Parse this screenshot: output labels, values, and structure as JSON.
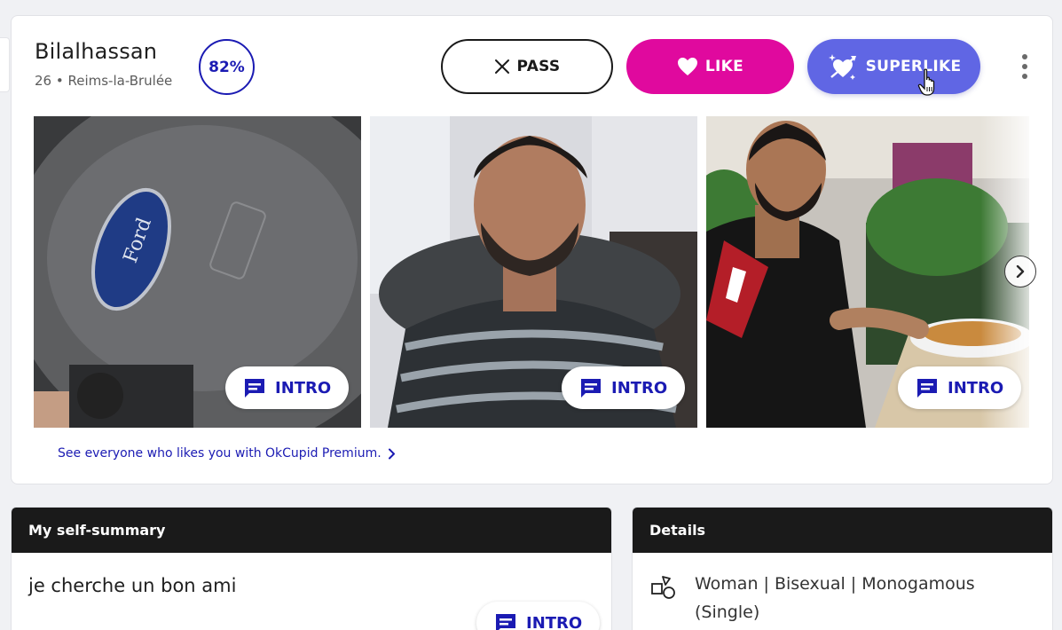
{
  "profile": {
    "name": "Bilalhassan",
    "meta": "26 • Reims-la-Brulée",
    "match": "82%"
  },
  "actions": {
    "pass_label": "PASS",
    "like_label": "LIKE",
    "superlike_label": "SUPERLIKE"
  },
  "photos": [
    {
      "intro_label": "INTRO",
      "icon": "steering-wheel-photo"
    },
    {
      "intro_label": "INTRO",
      "icon": "portrait-photo"
    },
    {
      "intro_label": "INTRO",
      "icon": "restaurant-photo"
    }
  ],
  "premium_link": "See everyone who likes you with OkCupid Premium.",
  "self_summary": {
    "title": "My self-summary",
    "text": "je cherche un bon ami",
    "intro_label": "INTRO"
  },
  "details": {
    "title": "Details",
    "line1": "Woman | Bisexual | Monogamous",
    "line2": "(Single)"
  },
  "colors": {
    "like": "#e0099e",
    "superlike": "#6066e4",
    "accent": "#1b1bb3",
    "panel_header": "#1a1a1a"
  }
}
